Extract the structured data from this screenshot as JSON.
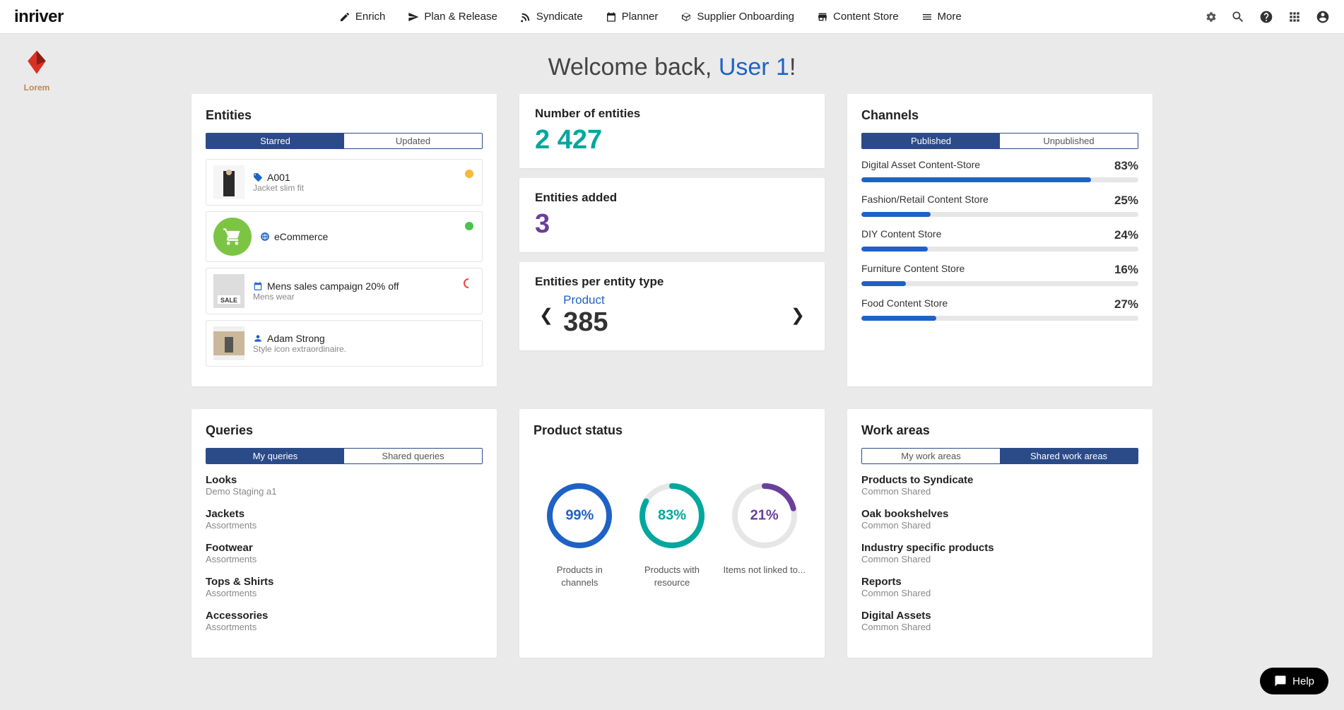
{
  "logo": "inriver",
  "brand": "Lorem",
  "nav": [
    "Enrich",
    "Plan & Release",
    "Syndicate",
    "Planner",
    "Supplier Onboarding",
    "Content Store",
    "More"
  ],
  "welcome_prefix": "Welcome back, ",
  "welcome_user": "User 1",
  "welcome_suffix": "!",
  "entities": {
    "title": "Entities",
    "tabs": [
      "Starred",
      "Updated"
    ],
    "items": [
      {
        "code": "A001",
        "sub": "Jacket slim fit",
        "icon": "tag"
      },
      {
        "code": "eCommerce",
        "sub": "",
        "icon": "globe"
      },
      {
        "code": "Mens sales campaign 20% off",
        "sub": "Mens wear",
        "icon": "calendar"
      },
      {
        "code": "Adam Strong",
        "sub": "Style icon extraordinaire.",
        "icon": "person"
      }
    ]
  },
  "num_entities": {
    "title": "Number of entities",
    "value": "2 427"
  },
  "entities_added": {
    "title": "Entities added",
    "value": "3"
  },
  "per_type": {
    "title": "Entities per entity type",
    "type": "Product",
    "value": "385"
  },
  "channels": {
    "title": "Channels",
    "tabs": [
      "Published",
      "Unpublished"
    ],
    "items": [
      {
        "name": "Digital Asset Content-Store",
        "pct": 83
      },
      {
        "name": "Fashion/Retail Content Store",
        "pct": 25
      },
      {
        "name": "DIY Content Store",
        "pct": 24
      },
      {
        "name": "Furniture Content Store",
        "pct": 16
      },
      {
        "name": "Food Content Store",
        "pct": 27
      }
    ]
  },
  "queries": {
    "title": "Queries",
    "tabs": [
      "My queries",
      "Shared queries"
    ],
    "items": [
      {
        "name": "Looks",
        "sub": "Demo Staging a1"
      },
      {
        "name": "Jackets",
        "sub": "Assortments"
      },
      {
        "name": "Footwear",
        "sub": "Assortments"
      },
      {
        "name": "Tops & Shirts",
        "sub": "Assortments"
      },
      {
        "name": "Accessories",
        "sub": "Assortments"
      }
    ]
  },
  "product_status": {
    "title": "Product status",
    "items": [
      {
        "pct": 99,
        "label": "Products in channels",
        "color": "#1e62c6"
      },
      {
        "pct": 83,
        "label": "Products with resource",
        "color": "#00a79d"
      },
      {
        "pct": 21,
        "label": "Items not linked to...",
        "color": "#6a3f9c"
      }
    ]
  },
  "work_areas": {
    "title": "Work areas",
    "tabs": [
      "My work areas",
      "Shared work areas"
    ],
    "items": [
      {
        "name": "Products to Syndicate",
        "sub": "Common Shared"
      },
      {
        "name": "Oak bookshelves",
        "sub": "Common Shared"
      },
      {
        "name": "Industry specific products",
        "sub": "Common Shared"
      },
      {
        "name": "Reports",
        "sub": "Common Shared"
      },
      {
        "name": "Digital Assets",
        "sub": "Common Shared"
      }
    ]
  },
  "help": "Help",
  "chart_data": [
    {
      "type": "bar",
      "title": "Channels Published",
      "categories": [
        "Digital Asset Content-Store",
        "Fashion/Retail Content Store",
        "DIY Content Store",
        "Furniture Content Store",
        "Food Content Store"
      ],
      "values": [
        83,
        25,
        24,
        16,
        27
      ],
      "ylim": [
        0,
        100
      ]
    },
    {
      "type": "pie",
      "title": "Product status",
      "series": [
        {
          "name": "Products in channels",
          "values": [
            99
          ]
        },
        {
          "name": "Products with resource",
          "values": [
            83
          ]
        },
        {
          "name": "Items not linked to...",
          "values": [
            21
          ]
        }
      ]
    }
  ]
}
